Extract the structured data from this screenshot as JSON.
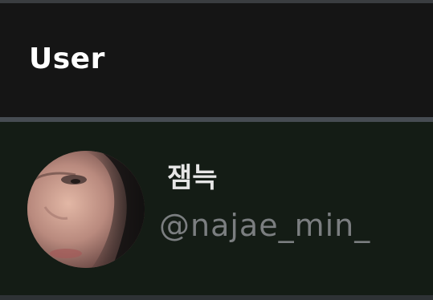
{
  "header": {
    "title": "User"
  },
  "user": {
    "display_name": "잼늑",
    "handle": "@najae_min_",
    "avatar": "profile-photo"
  },
  "colors": {
    "header_bg": "#151515",
    "row_bg": "#141c15",
    "divider": "#464c52",
    "name": "#e6e6e6",
    "handle": "#7b7e80"
  }
}
